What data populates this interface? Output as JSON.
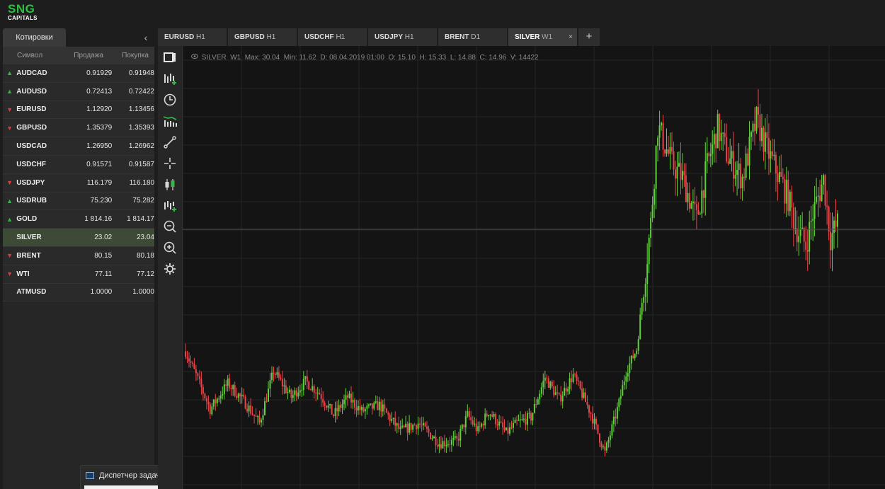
{
  "brand": {
    "line1": "SNG",
    "line2": "CAPITALS"
  },
  "left_panel": {
    "tab_label": "Котировки",
    "collapse_icon": "chevron-left-icon",
    "columns": {
      "symbol": "Символ",
      "sell": "Продажа",
      "buy": "Покупка"
    },
    "quotes": [
      {
        "symbol": "AUDCAD",
        "sell": "0.91929",
        "buy": "0.91948",
        "trend": "up"
      },
      {
        "symbol": "AUDUSD",
        "sell": "0.72413",
        "buy": "0.72422",
        "trend": "up"
      },
      {
        "symbol": "EURUSD",
        "sell": "1.12920",
        "buy": "1.13456",
        "trend": "down"
      },
      {
        "symbol": "GBPUSD",
        "sell": "1.35379",
        "buy": "1.35393",
        "trend": "down"
      },
      {
        "symbol": "USDCAD",
        "sell": "1.26950",
        "buy": "1.26962",
        "trend": "none"
      },
      {
        "symbol": "USDCHF",
        "sell": "0.91571",
        "buy": "0.91587",
        "trend": "none"
      },
      {
        "symbol": "USDJPY",
        "sell": "116.179",
        "buy": "116.180",
        "trend": "down"
      },
      {
        "symbol": "USDRUB",
        "sell": "75.230",
        "buy": "75.282",
        "trend": "up"
      },
      {
        "symbol": "GOLD",
        "sell": "1 814.16",
        "buy": "1 814.17",
        "trend": "up"
      },
      {
        "symbol": "SILVER",
        "sell": "23.02",
        "buy": "23.04",
        "trend": "none",
        "selected": true
      },
      {
        "symbol": "BRENT",
        "sell": "80.15",
        "buy": "80.18",
        "trend": "down"
      },
      {
        "symbol": "WTI",
        "sell": "77.11",
        "buy": "77.12",
        "trend": "down"
      },
      {
        "symbol": "ATMUSD",
        "sell": "1.0000",
        "buy": "1.0000",
        "trend": "none"
      }
    ]
  },
  "taskbar_item": {
    "label": "Диспетчер задач",
    "icon": "task-manager-icon"
  },
  "chart_tabs": [
    {
      "symbol": "EURUSD",
      "tf": "H1",
      "active": false
    },
    {
      "symbol": "GBPUSD",
      "tf": "H1",
      "active": false
    },
    {
      "symbol": "USDCHF",
      "tf": "H1",
      "active": false
    },
    {
      "symbol": "USDJPY",
      "tf": "H1",
      "active": false
    },
    {
      "symbol": "BRENT",
      "tf": "D1",
      "active": false
    },
    {
      "symbol": "SILVER",
      "tf": "W1",
      "active": true
    }
  ],
  "close_tab_glyph": "×",
  "add_tab_glyph": "+",
  "toolbar": [
    "chart-window-icon",
    "add-indicator-icon",
    "clock-icon",
    "volume-bars-icon",
    "trendline-icon",
    "crosshair-icon",
    "candlestick-icon",
    "add-bars-icon",
    "zoom-out-icon",
    "zoom-in-icon",
    "settings-icon"
  ],
  "chart_info": {
    "symbol": "SILVER",
    "timeframe": "W1",
    "max": "Max: 30.04",
    "min": "Min: 11.62",
    "date": "D: 08.04.2019 01:00",
    "open": "O: 15.10",
    "high": "H: 15.33",
    "low": "L: 14.88",
    "close": "C: 14.96",
    "volume": "V: 14422"
  },
  "colors": {
    "bull": "#5fcf3a",
    "bear": "#e8454a",
    "grid": "#262626",
    "brand_green": "#2fbf45",
    "selected_row": "#3d4a35"
  },
  "chart_data": {
    "type": "candlestick",
    "symbol": "SILVER",
    "timeframe": "W1",
    "ylim": [
      11.62,
      30.04
    ],
    "current_price": 23.02,
    "grid": true,
    "close_path_anchors": [
      [
        0,
        16.9
      ],
      [
        6,
        15.7
      ],
      [
        14,
        14.0
      ],
      [
        24,
        15.3
      ],
      [
        34,
        14.3
      ],
      [
        42,
        13.3
      ],
      [
        50,
        15.9
      ],
      [
        60,
        14.6
      ],
      [
        68,
        15.4
      ],
      [
        76,
        14.8
      ],
      [
        84,
        13.7
      ],
      [
        92,
        14.6
      ],
      [
        100,
        13.9
      ],
      [
        110,
        14.2
      ],
      [
        122,
        12.9
      ],
      [
        132,
        13.3
      ],
      [
        144,
        12.3
      ],
      [
        154,
        12.4
      ],
      [
        160,
        13.7
      ],
      [
        166,
        12.9
      ],
      [
        172,
        13.9
      ],
      [
        182,
        12.8
      ],
      [
        188,
        13.3
      ],
      [
        196,
        13.6
      ],
      [
        204,
        15.6
      ],
      [
        212,
        14.5
      ],
      [
        220,
        15.7
      ],
      [
        230,
        13.8
      ],
      [
        238,
        11.8
      ],
      [
        246,
        14.3
      ],
      [
        250,
        15.9
      ],
      [
        256,
        17.0
      ],
      [
        264,
        23.3
      ],
      [
        268,
        28.2
      ],
      [
        276,
        26.3
      ],
      [
        282,
        25.6
      ],
      [
        290,
        23.5
      ],
      [
        296,
        26.2
      ],
      [
        302,
        28.1
      ],
      [
        308,
        26.6
      ],
      [
        316,
        25.6
      ],
      [
        324,
        28.5
      ],
      [
        330,
        27.0
      ],
      [
        336,
        25.8
      ],
      [
        342,
        24.6
      ],
      [
        346,
        23.2
      ],
      [
        352,
        22.2
      ],
      [
        356,
        23.8
      ],
      [
        362,
        25.5
      ],
      [
        366,
        22.6
      ],
      [
        370,
        23.3
      ]
    ]
  }
}
